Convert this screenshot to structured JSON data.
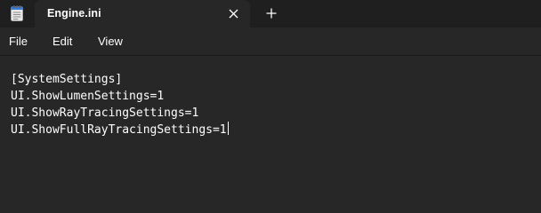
{
  "tab": {
    "title": "Engine.ini",
    "close_icon": "close-icon",
    "new_tab_icon": "plus-icon"
  },
  "menu": {
    "file": "File",
    "edit": "Edit",
    "view": "View"
  },
  "editor": {
    "lines": [
      "[SystemSettings]",
      "UI.ShowLumenSettings=1",
      "UI.ShowRayTracingSettings=1",
      "UI.ShowFullRayTracingSettings=1"
    ]
  },
  "colors": {
    "titlebar_bg": "#1f1f1f",
    "editor_bg": "#272727",
    "text": "#ffffff"
  }
}
